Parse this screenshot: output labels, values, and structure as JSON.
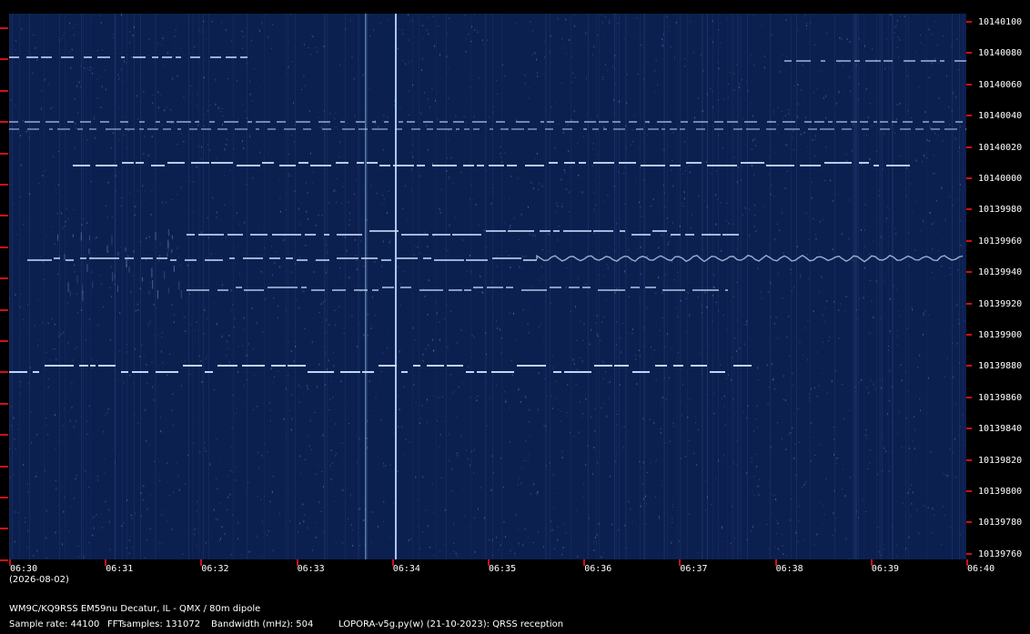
{
  "freq_labels": [
    "10140100",
    "10140080",
    "10140060",
    "10140040",
    "10140020",
    "10140000",
    "10139980",
    "10139960",
    "10139940",
    "10139920",
    "10139900",
    "10139880",
    "10139860",
    "10139840",
    "10139820",
    "10139800",
    "10139780",
    "10139760"
  ],
  "time_labels": [
    "06:30",
    "06:31",
    "06:32",
    "06:33",
    "06:34",
    "06:35",
    "06:36",
    "06:37",
    "06:38",
    "06:39",
    "06:40"
  ],
  "date": "(2026-08-02)",
  "station": "WM9C/KQ9RSS EM59nu Decatur, IL - QMX / 80m dipole",
  "sample_rate": "Sample rate: 44100",
  "fft_samples": "FFTsamples: 131072",
  "bandwidth": "Bandwidth (mHz): 504",
  "software": "LOPORA-v5g.py(w) (21-10-2023): QRSS reception",
  "colors": {
    "background": "#0c2050",
    "signal": "#c8e0ff",
    "tick": "#d01010"
  }
}
